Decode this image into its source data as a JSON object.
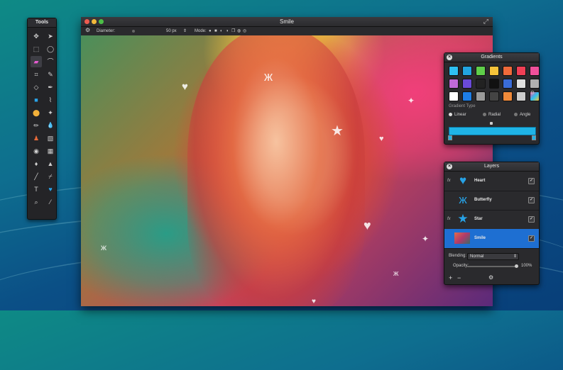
{
  "tools": {
    "title": "Tools",
    "items": [
      {
        "icon": "move-icon",
        "glyph": "✥"
      },
      {
        "icon": "arrow-icon",
        "glyph": "➤"
      },
      {
        "icon": "rect-select-icon",
        "glyph": "⬚"
      },
      {
        "icon": "ellipse-select-icon",
        "glyph": "◯"
      },
      {
        "icon": "eraser-icon",
        "glyph": "▰"
      },
      {
        "icon": "lasso-icon",
        "glyph": "⌒"
      },
      {
        "icon": "crop-icon",
        "glyph": "⌗"
      },
      {
        "icon": "pencil-icon",
        "glyph": "✎"
      },
      {
        "icon": "eraser-small-icon",
        "glyph": "◇"
      },
      {
        "icon": "pen-icon",
        "glyph": "✒"
      },
      {
        "icon": "square-shape-icon",
        "glyph": "■"
      },
      {
        "icon": "brush-icon",
        "glyph": "⌇"
      },
      {
        "icon": "ellipse-shape-icon",
        "glyph": "⬤"
      },
      {
        "icon": "magic-wand-icon",
        "glyph": "✦"
      },
      {
        "icon": "pencil-dark-icon",
        "glyph": "✏"
      },
      {
        "icon": "paint-drop-icon",
        "glyph": "💧"
      },
      {
        "icon": "stamp-icon",
        "glyph": "♟"
      },
      {
        "icon": "blur-icon",
        "glyph": "▧"
      },
      {
        "icon": "eye-icon",
        "glyph": "◉"
      },
      {
        "icon": "smudge-icon",
        "glyph": "▦"
      },
      {
        "icon": "drop-icon",
        "glyph": "♦"
      },
      {
        "icon": "sharpen-icon",
        "glyph": "▲"
      },
      {
        "icon": "line-icon",
        "glyph": "╱"
      },
      {
        "icon": "brush-alt-icon",
        "glyph": "⌿"
      },
      {
        "icon": "text-icon",
        "glyph": "T"
      },
      {
        "icon": "heart-shape-icon",
        "glyph": "♥"
      },
      {
        "icon": "zoom-icon",
        "glyph": "⌕"
      },
      {
        "icon": "eyedropper-icon",
        "glyph": "⁄"
      }
    ]
  },
  "window": {
    "title": "Smile",
    "diameter_label": "Diameter:",
    "diameter_value": "50 px",
    "mode_label": "Mode:"
  },
  "gradients": {
    "title": "Gradients",
    "swatches": [
      "#2ec0f2",
      "#22a4e0",
      "#5fce4a",
      "#f5c33a",
      "#f06a3a",
      "#f03f55",
      "#f0509a",
      "#c06ad8",
      "#6a4ad8",
      "#222222",
      "#111111",
      "#3a6cd8",
      "#e0e0e0",
      "#b0b0b0",
      "#ffffff",
      "#1e7ee6",
      "#9a9a9a",
      "#444444",
      "#f08a3a",
      "#cccccc",
      "#e5487a"
    ],
    "gradient_type_label": "Gradient Type",
    "types": [
      "Linear",
      "Radial",
      "Angle"
    ],
    "bar_color": "#1fb4e6"
  },
  "layers": {
    "title": "Layers",
    "rows": [
      {
        "name": "Heart",
        "fx": "fx",
        "icon": "heart-layer-icon",
        "glyph": "♥"
      },
      {
        "name": "Butterfly",
        "fx": "",
        "icon": "butterfly-layer-icon",
        "glyph": "ж"
      },
      {
        "name": "Star",
        "fx": "fx",
        "icon": "star-layer-icon",
        "glyph": "★"
      },
      {
        "name": "Smile",
        "fx": "",
        "icon": "photo-thumbnail",
        "glyph": ""
      }
    ],
    "blending_label": "Blending:",
    "blending_value": "Normal",
    "opacity_label": "Opacity:",
    "opacity_value": "100%"
  }
}
